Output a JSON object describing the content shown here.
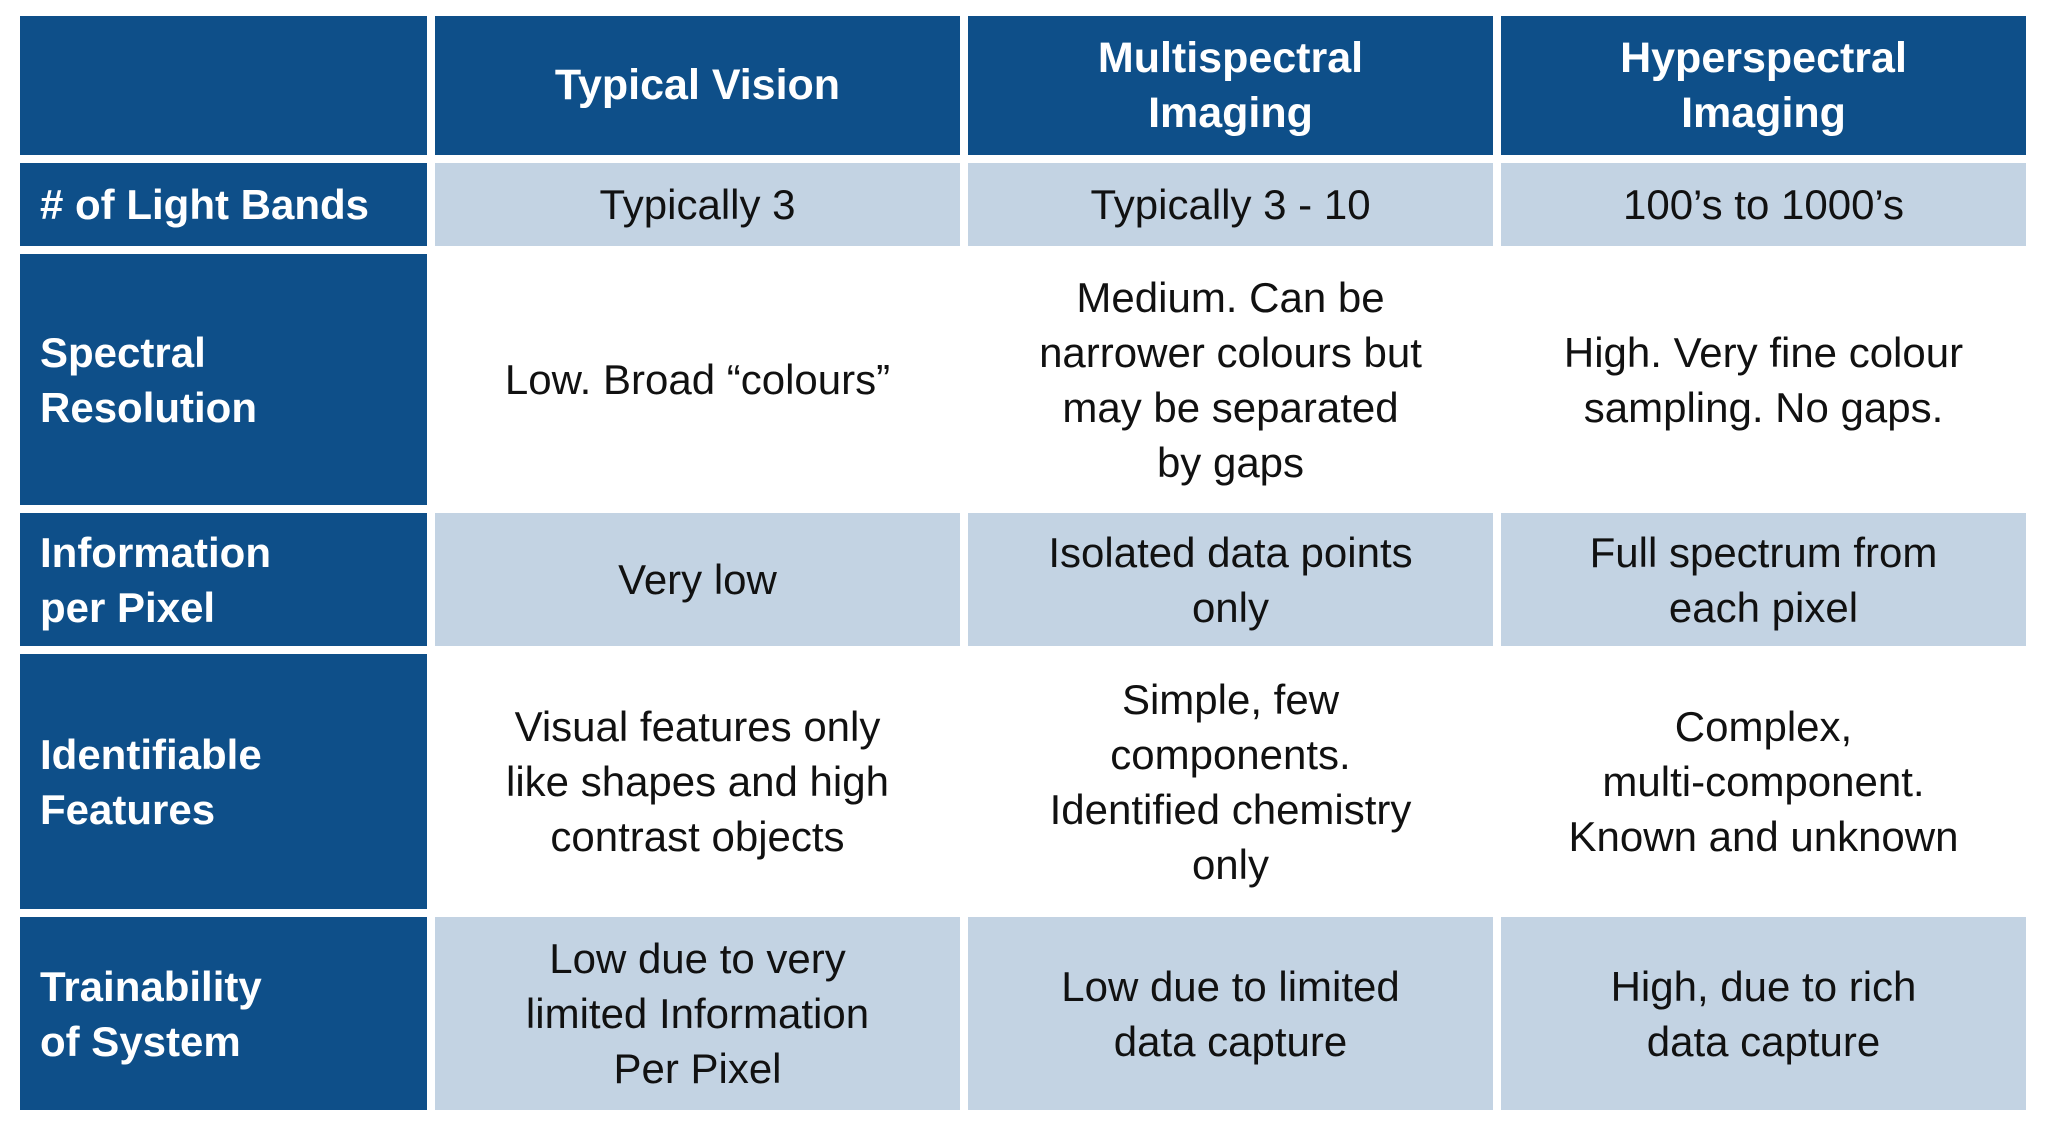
{
  "table": {
    "columns": [
      "",
      "Typical Vision",
      "Multispectral\nImaging",
      "Hyperspectral\nImaging"
    ],
    "rows": [
      {
        "label": "# of Light Bands",
        "shaded": true,
        "values": [
          "Typically 3",
          "Typically 3 - 10",
          "100’s to 1000’s"
        ]
      },
      {
        "label": "Spectral\nResolution",
        "shaded": false,
        "values": [
          "Low. Broad “colours”",
          "Medium. Can be\nnarrower colours but\nmay be separated\nby gaps",
          "High. Very fine colour\nsampling. No gaps."
        ]
      },
      {
        "label": "Information\nper Pixel",
        "shaded": true,
        "values": [
          "Very low",
          "Isolated data points\nonly",
          "Full spectrum from\neach pixel"
        ]
      },
      {
        "label": "Identifiable\nFeatures",
        "shaded": false,
        "values": [
          "Visual features only\nlike shapes and high\ncontrast objects",
          "Simple, few\ncomponents.\nIdentified chemistry\nonly",
          "Complex,\nmulti-component.\nKnown and unknown"
        ]
      },
      {
        "label": "Trainability\nof System",
        "shaded": true,
        "values": [
          "Low due to very\nlimited Information\nPer Pixel",
          "Low due to limited\ndata capture",
          "High, due to rich\ndata capture"
        ]
      }
    ]
  },
  "colors": {
    "header_bg": "#0e4f89",
    "header_text": "#ffffff",
    "shaded_row_bg": "#c3d3e3",
    "plain_row_bg": "#ffffff",
    "body_text": "#111111"
  }
}
